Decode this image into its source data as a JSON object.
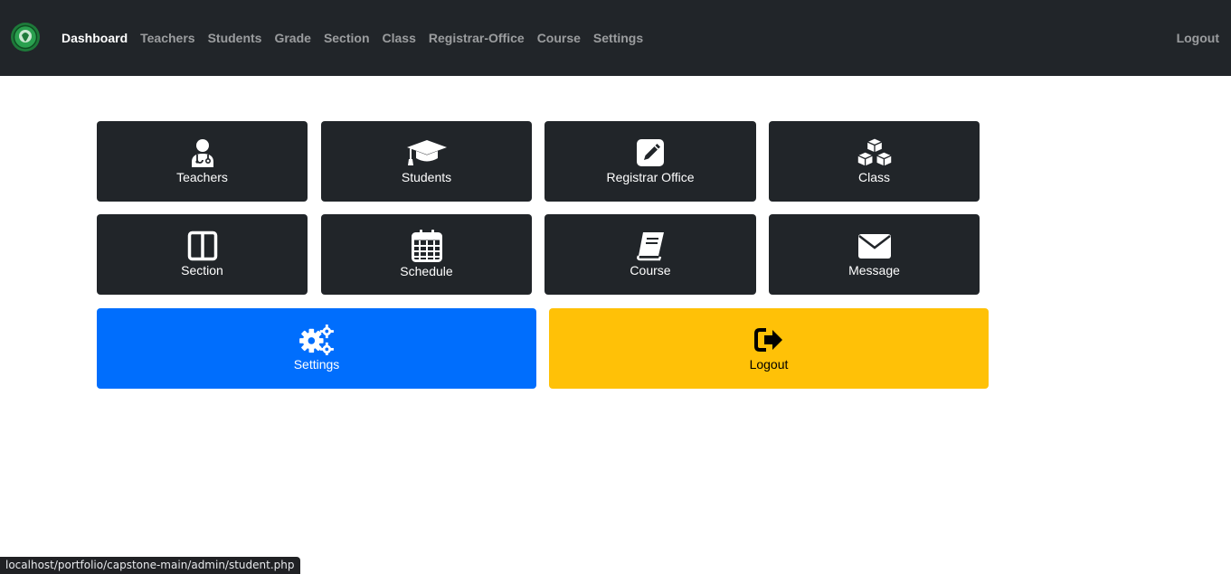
{
  "nav": {
    "links": [
      "Dashboard",
      "Teachers",
      "Students",
      "Grade",
      "Section",
      "Class",
      "Registrar-Office",
      "Course",
      "Settings"
    ],
    "logout": "Logout"
  },
  "tiles": {
    "teachers": {
      "label": "Teachers",
      "icon": "user-doctor-icon"
    },
    "students": {
      "label": "Students",
      "icon": "graduation-cap-icon"
    },
    "registrar": {
      "label": "Registrar Office",
      "icon": "pen-square-icon"
    },
    "class": {
      "label": "Class",
      "icon": "cubes-icon"
    },
    "section": {
      "label": "Section",
      "icon": "columns-icon"
    },
    "schedule": {
      "label": "Schedule",
      "icon": "calendar-icon"
    },
    "course": {
      "label": "Course",
      "icon": "book-icon"
    },
    "message": {
      "label": "Message",
      "icon": "envelope-icon"
    },
    "settings": {
      "label": "Settings",
      "icon": "gears-icon"
    },
    "logout": {
      "label": "Logout",
      "icon": "sign-out-icon"
    }
  },
  "status_url": "localhost/portfolio/capstone-main/admin/student.php",
  "colors": {
    "navbar": "#212529",
    "tile_dark": "#212529",
    "tile_primary": "#006efd",
    "tile_warning": "#ffc107"
  }
}
